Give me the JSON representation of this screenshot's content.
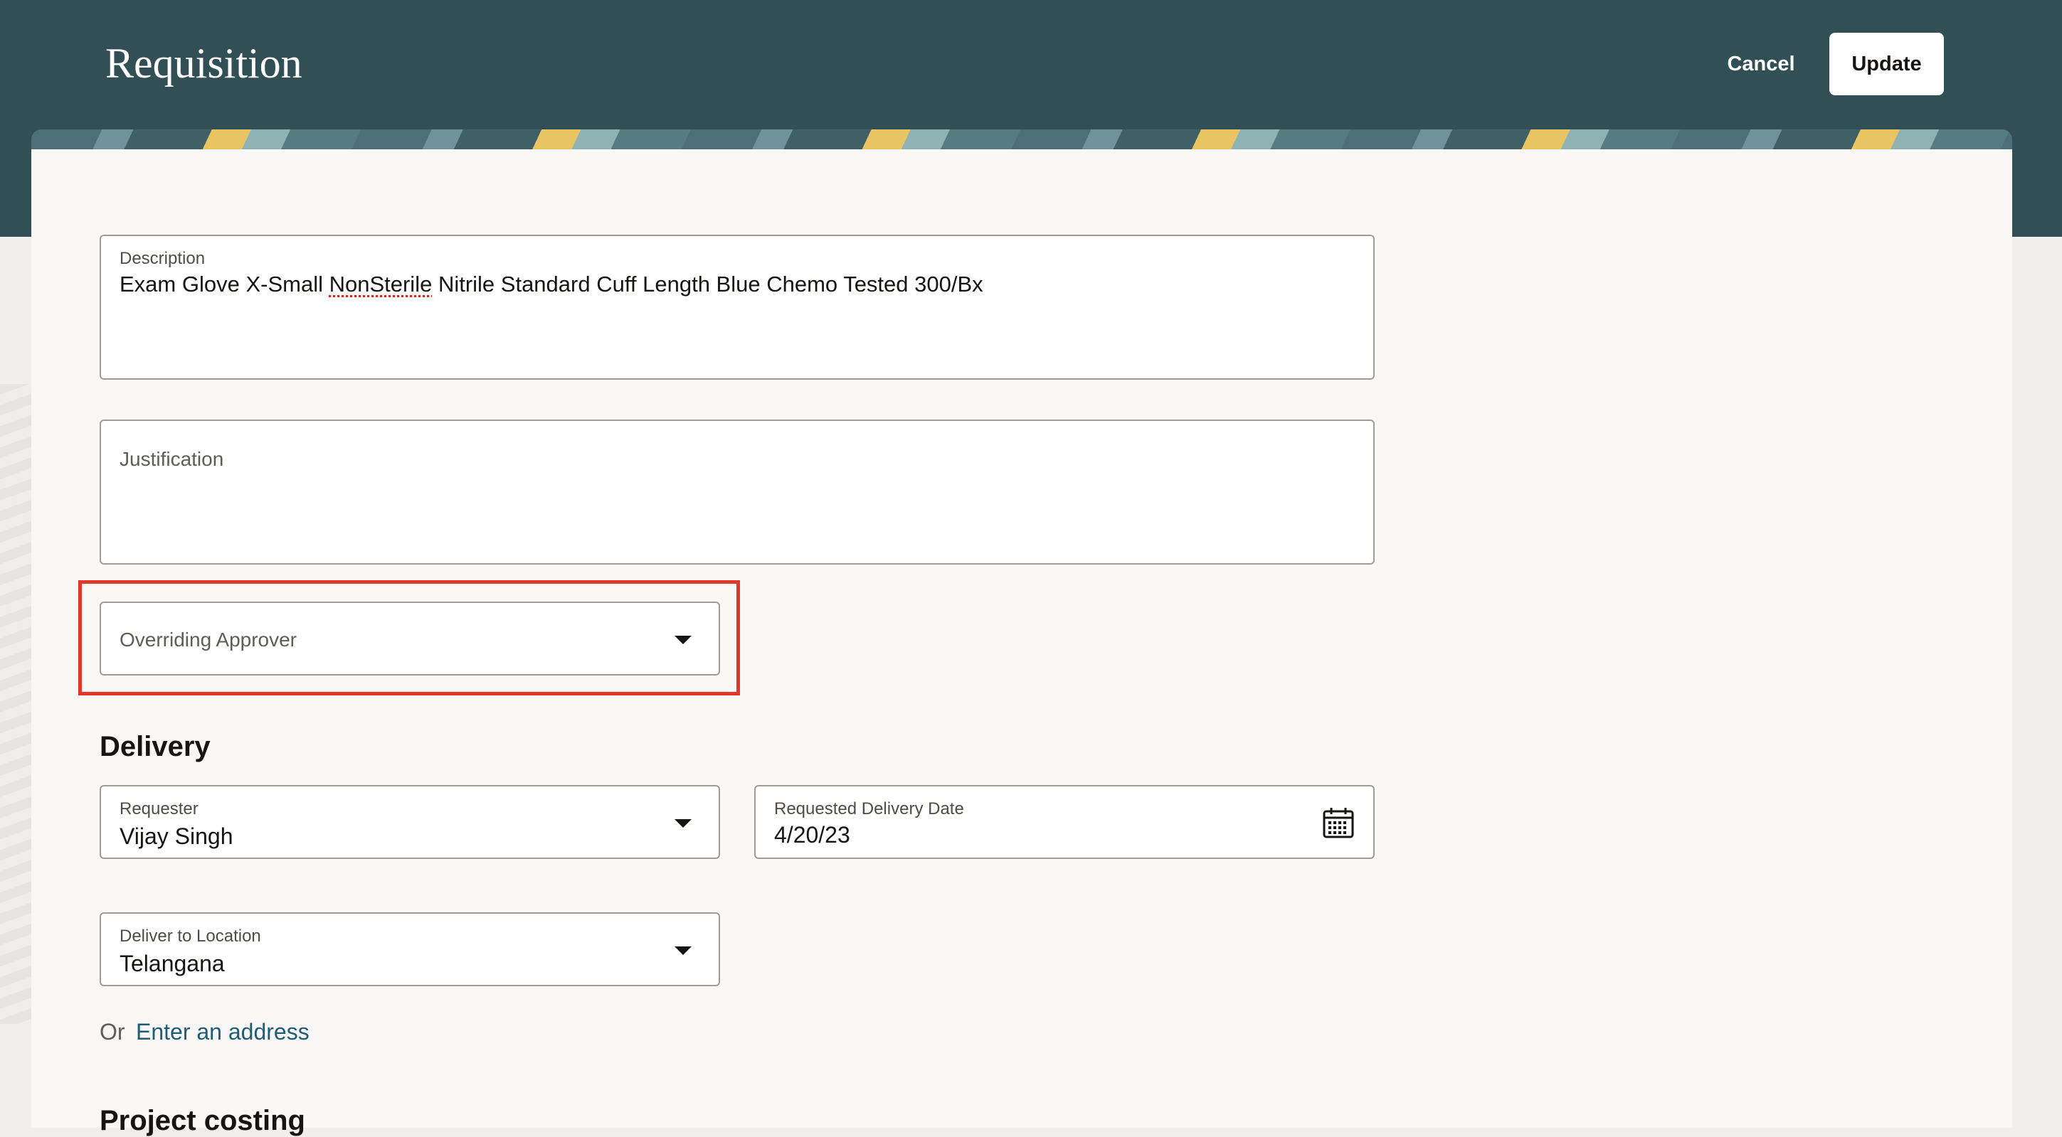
{
  "header": {
    "title": "Requisition",
    "cancel_label": "Cancel",
    "update_label": "Update"
  },
  "form": {
    "description": {
      "label": "Description",
      "value_start": "Exam Glove X-Small ",
      "value_flagged": "NonSterile",
      "value_end": " Nitrile Standard Cuff Length Blue Chemo Tested 300/Bx"
    },
    "justification": {
      "label": "Justification",
      "value": ""
    },
    "overriding_approver": {
      "label": "Overriding Approver",
      "value": ""
    }
  },
  "delivery": {
    "section_title": "Delivery",
    "requester": {
      "label": "Requester",
      "value": "Vijay Singh"
    },
    "requested_delivery_date": {
      "label": "Requested Delivery Date",
      "value": "4/20/23"
    },
    "deliver_to_location": {
      "label": "Deliver to Location",
      "value": "Telangana"
    },
    "or_text": "Or",
    "enter_address_link": "Enter an address"
  },
  "project_costing": {
    "section_title": "Project costing"
  },
  "icons": {
    "dropdown": "chevron-down-icon",
    "calendar": "calendar-icon"
  },
  "colors": {
    "header_bg": "#324f56",
    "highlight": "#e0392b",
    "link": "#1f5c7a"
  }
}
